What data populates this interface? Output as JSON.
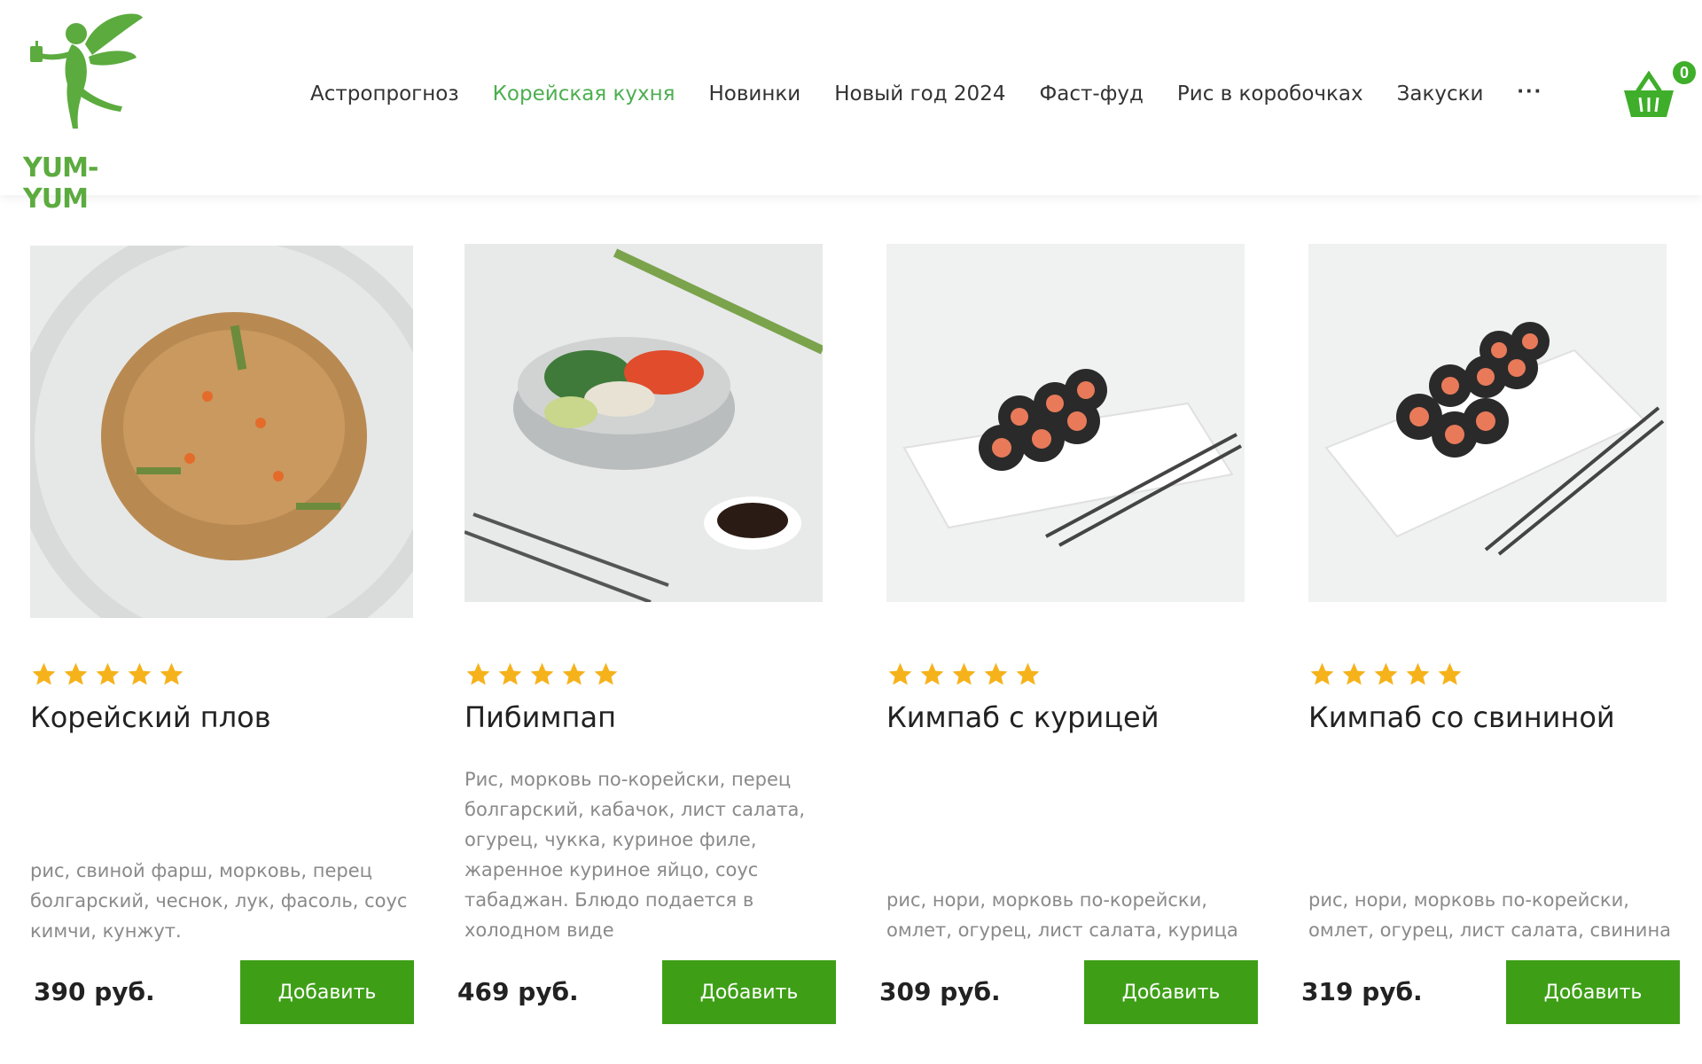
{
  "brand": {
    "name": "YUM-YUM",
    "accent": "#3e9f17",
    "logo_color": "#5cab3f"
  },
  "nav": {
    "items": [
      {
        "label": "Астропрогноз",
        "active": false
      },
      {
        "label": "Корейская кухня",
        "active": true
      },
      {
        "label": "Новинки",
        "active": false
      },
      {
        "label": "Новый год 2024",
        "active": false
      },
      {
        "label": "Фаст-фуд",
        "active": false
      },
      {
        "label": "Рис в коробочках",
        "active": false
      },
      {
        "label": "Закуски",
        "active": false
      }
    ],
    "more_label": "···"
  },
  "cart": {
    "count": "0",
    "icon": "basket-icon"
  },
  "products": [
    {
      "title": "Корейский плов",
      "rating": 5,
      "description": "рис, свиной фарш, морковь, перец болгарский, чеснок, лук, фасоль, соус кимчи, кунжут.",
      "price": "390 руб.",
      "button": "Добавить"
    },
    {
      "title": "Пибимпап",
      "rating": 5,
      "description": "Рис, морковь по-корейски, перец болгарский, кабачок, лист салата, огурец, чукка, куриное филе, жаренное куриное яйцо, соус табаджан. Блюдо подается в холодном виде",
      "price": "469 руб.",
      "button": "Добавить"
    },
    {
      "title": "Кимпаб с курицей",
      "rating": 5,
      "description": "рис, нори, морковь по-корейски, омлет, огурец, лист салата, курица",
      "price": "309 руб.",
      "button": "Добавить"
    },
    {
      "title": "Кимпаб со свининой",
      "rating": 5,
      "description": "рис, нори, морковь по-корейски, омлет, огурец, лист салата, свинина",
      "price": "319 руб.",
      "button": "Добавить"
    }
  ]
}
